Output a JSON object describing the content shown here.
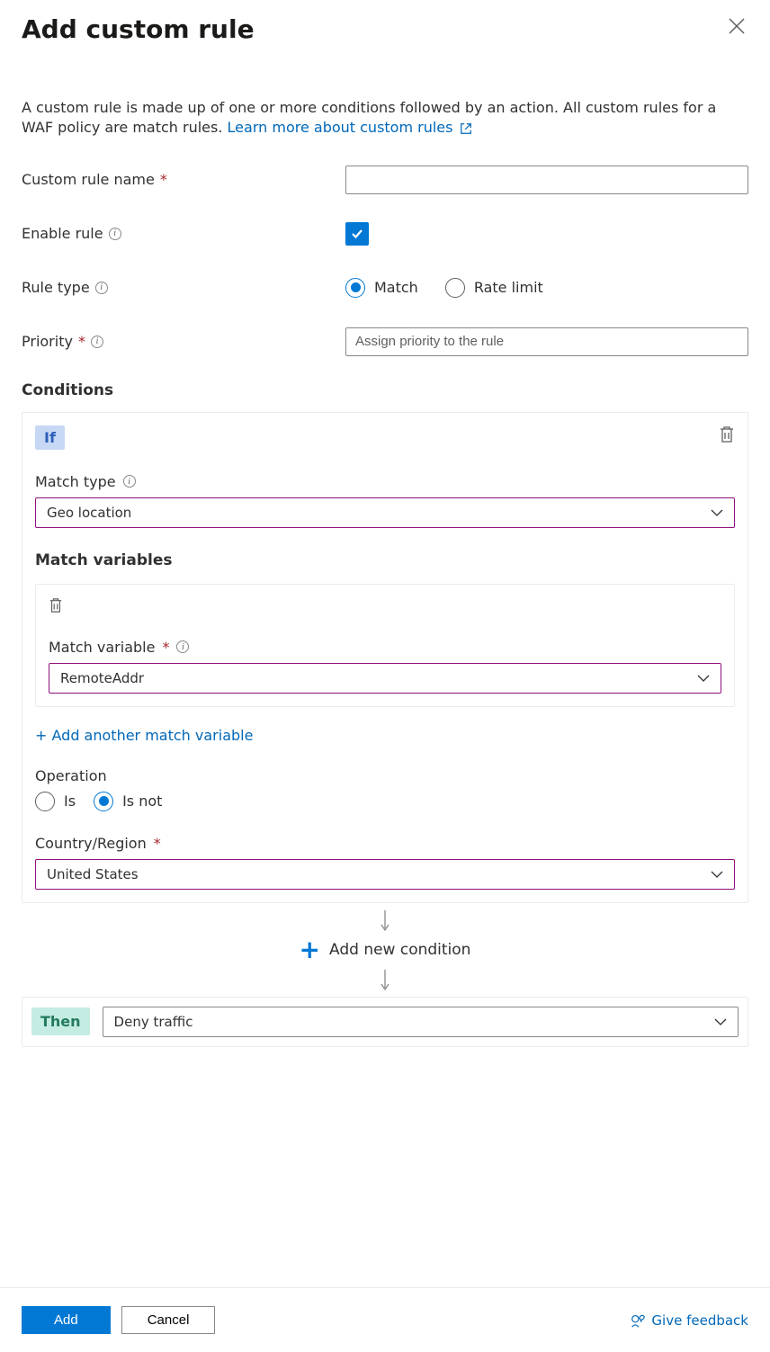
{
  "header": {
    "title": "Add custom rule"
  },
  "description": {
    "text": "A custom rule is made up of one or more conditions followed by an action. All custom rules for a WAF policy are match rules.",
    "link": "Learn more about custom rules"
  },
  "form": {
    "nameLabel": "Custom rule name",
    "nameValue": "",
    "enableLabel": "Enable rule",
    "enableChecked": true,
    "ruleTypeLabel": "Rule type",
    "ruleTypes": [
      {
        "label": "Match",
        "checked": true
      },
      {
        "label": "Rate limit",
        "checked": false
      }
    ],
    "priorityLabel": "Priority",
    "priorityPlaceholder": "Assign priority to the rule"
  },
  "conditions": {
    "heading": "Conditions",
    "ifLabel": "If",
    "matchTypeLabel": "Match type",
    "matchTypeValue": "Geo location",
    "matchVariablesHeading": "Match variables",
    "matchVariableLabel": "Match variable",
    "matchVariableValue": "RemoteAddr",
    "addVariableLink": "+ Add another match variable",
    "operationLabel": "Operation",
    "operations": [
      {
        "label": "Is",
        "checked": false
      },
      {
        "label": "Is not",
        "checked": true
      }
    ],
    "countryLabel": "Country/Region",
    "countryValue": "United States",
    "addConditionLabel": "Add new condition"
  },
  "then": {
    "badge": "Then",
    "actionValue": "Deny traffic"
  },
  "footer": {
    "add": "Add",
    "cancel": "Cancel",
    "feedback": "Give feedback"
  }
}
